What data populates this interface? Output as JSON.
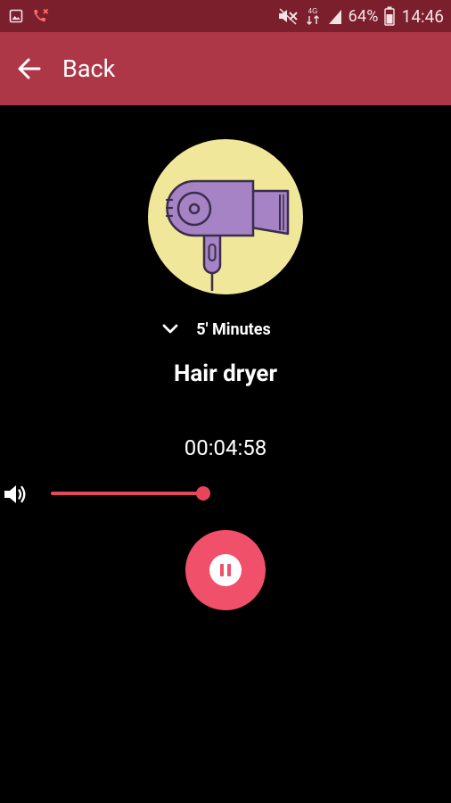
{
  "status_bar": {
    "icons_left": [
      "gallery-notification-icon",
      "missed-call-icon"
    ],
    "icons_right": [
      "mute-icon",
      "data-4g-icon",
      "signal-icon",
      "battery-icon"
    ],
    "network_type": "4G",
    "battery": "64%",
    "time": "14:46"
  },
  "app_bar": {
    "back_label": "Back"
  },
  "player": {
    "duration_label": "5' Minutes",
    "title": "Hair dryer",
    "timer": "00:04:58",
    "volume_level": 0.9,
    "state": "playing"
  },
  "colors": {
    "status_bar": "#7c1f2c",
    "app_bar": "#ae3747",
    "accent": "#f0506a",
    "illustration_bg": "#f0e79a",
    "dryer_body": "#a583c4"
  }
}
